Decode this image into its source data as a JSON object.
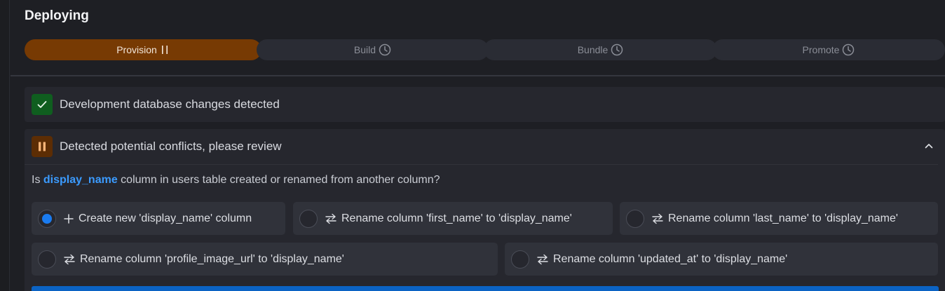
{
  "page": {
    "title": "Deploying"
  },
  "stepper": {
    "steps": [
      {
        "label": "Provision",
        "state": "active",
        "icon": "pause-icon"
      },
      {
        "label": "Build",
        "state": "pending",
        "icon": "clock-icon"
      },
      {
        "label": "Bundle",
        "state": "pending",
        "icon": "clock-icon"
      },
      {
        "label": "Promote",
        "state": "pending",
        "icon": "clock-icon"
      }
    ]
  },
  "success_card": {
    "title": "Development database changes detected",
    "icon": "check-icon"
  },
  "conflict_card": {
    "title": "Detected potential conflicts, please review",
    "icon": "pause-icon",
    "question": {
      "prefix": "Is ",
      "column": "display_name",
      "suffix": " column in users table created or renamed from another column?"
    },
    "options": [
      {
        "label": "Create new 'display_name' column",
        "icon": "plus-icon",
        "selected": true
      },
      {
        "label": "Rename column 'first_name' to 'display_name'",
        "icon": "swap-icon",
        "selected": false
      },
      {
        "label": "Rename column 'last_name' to 'display_name'",
        "icon": "swap-icon",
        "selected": false
      },
      {
        "label": "Rename column 'profile_image_url' to 'display_name'",
        "icon": "swap-icon",
        "selected": false
      },
      {
        "label": "Rename column 'updated_at' to 'display_name'",
        "icon": "swap-icon",
        "selected": false
      }
    ]
  },
  "colors": {
    "active_step": "#773a03",
    "accent": "#3b9bff",
    "success": "#0f5e1f",
    "warning": "#5c2d04",
    "primary_button": "#0b63c4"
  }
}
